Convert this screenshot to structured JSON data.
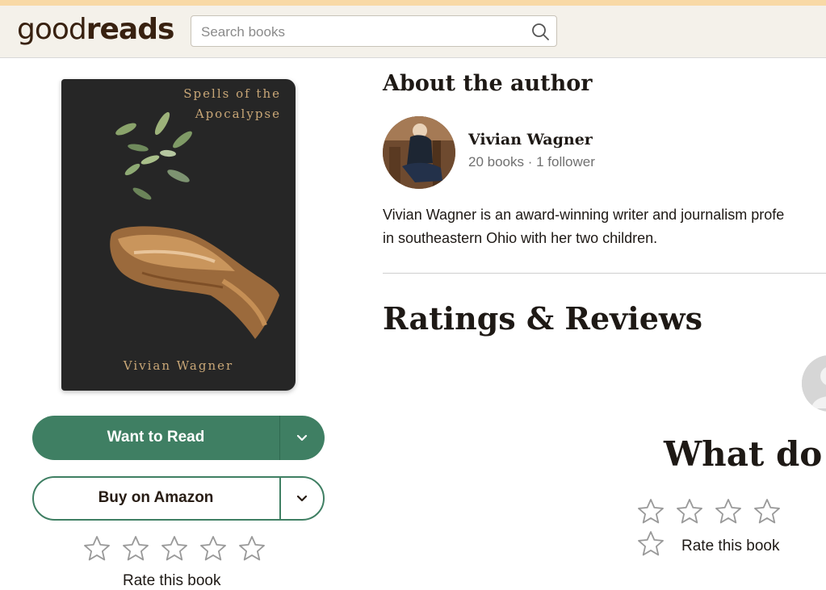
{
  "header": {
    "logo_good": "good",
    "logo_reads": "reads",
    "search_placeholder": "Search books"
  },
  "book": {
    "cover_title_line1": "Spells of the",
    "cover_title_line2": "Apocalypse",
    "cover_author": "Vivian Wagner"
  },
  "actions": {
    "want_to_read": "Want to Read",
    "buy_on_amazon": "Buy on Amazon",
    "rate_label_left": "Rate this book"
  },
  "about": {
    "heading": "About the author",
    "author_name": "Vivian Wagner",
    "author_meta": "20 books · 1 follower",
    "bio_line1": "Vivian Wagner is an award-winning writer and journalism profe",
    "bio_line2": "in southeastern Ohio with her two children."
  },
  "reviews": {
    "heading": "Ratings & Reviews",
    "prompt": "What do y",
    "rate_label_right": "Rate this book"
  },
  "colors": {
    "brand_green": "#3f7f63",
    "header_bg": "#f4f1ea",
    "cover_gold": "#c9a777"
  }
}
